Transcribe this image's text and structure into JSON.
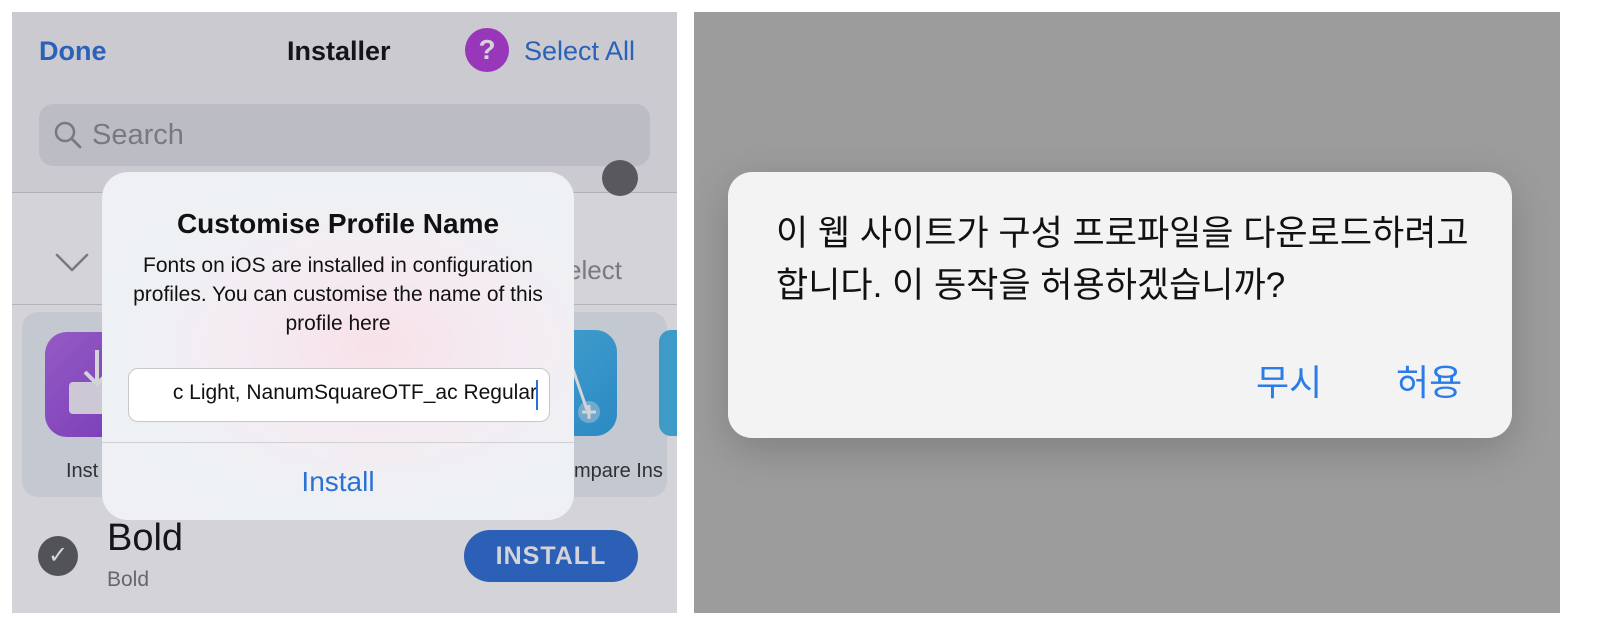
{
  "installer": {
    "nav": {
      "done_label": "Done",
      "title": "Installer",
      "help_glyph": "?",
      "select_all_label": "Select All"
    },
    "search": {
      "placeholder": "Search"
    },
    "partial_select_label": "elect",
    "apps": {
      "left_label": "Inst",
      "right_label": "mpare Ins"
    },
    "font_row": {
      "name": "Bold",
      "style": "Bold",
      "install_label": "INSTALL"
    },
    "dialog": {
      "title": "Customise Profile Name",
      "message": "Fonts on iOS are installed in configuration profiles. You can customise the name of this profile here",
      "input_value": "c Light, NanumSquareOTF_ac Regular",
      "install_label": "Install"
    },
    "colors": {
      "accent": "#2b71d6",
      "help_button": "#b43bd9"
    }
  },
  "alert": {
    "message": "이 웹 사이트가 구성 프로파일을 다운로드하려고 합니다. 이 동작을 허용하겠습니까?",
    "ignore_label": "무시",
    "allow_label": "허용",
    "colors": {
      "action": "#2b7be8",
      "backdrop": "#9c9c9c"
    }
  }
}
